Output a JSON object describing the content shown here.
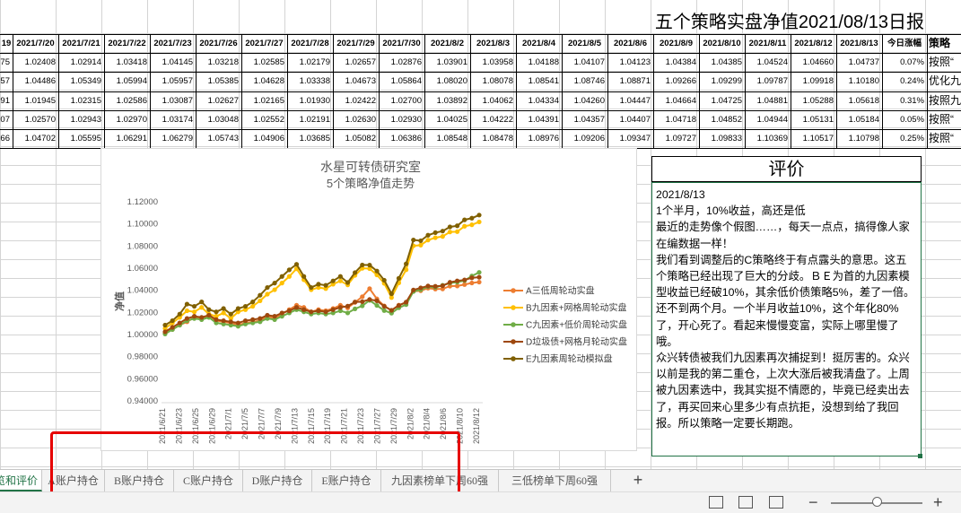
{
  "sheet_title": "五个策略实盘净值2021/08/13日报",
  "table": {
    "first_header": "19",
    "dates": [
      "2021/7/20",
      "2021/7/21",
      "2021/7/22",
      "2021/7/23",
      "2021/7/26",
      "2021/7/27",
      "2021/7/28",
      "2021/7/29",
      "2021/7/30",
      "2021/8/2",
      "2021/8/3",
      "2021/8/4",
      "2021/8/5",
      "2021/8/6",
      "2021/8/9",
      "2021/8/10",
      "2021/8/11",
      "2021/8/12",
      "2021/8/13"
    ],
    "change_header": "今日涨幅",
    "strategy_header": "策略",
    "rows": [
      {
        "first": "75",
        "values": [
          "1.02408",
          "1.02914",
          "1.03418",
          "1.04145",
          "1.03218",
          "1.02585",
          "1.02179",
          "1.02657",
          "1.02876",
          "1.03901",
          "1.03958",
          "1.04188",
          "1.04107",
          "1.04123",
          "1.04384",
          "1.04385",
          "1.04524",
          "1.04660",
          "1.04737"
        ],
        "change": "0.07%",
        "strategy": "按照“"
      },
      {
        "first": "57",
        "values": [
          "1.04486",
          "1.05349",
          "1.05994",
          "1.05957",
          "1.05385",
          "1.04628",
          "1.03338",
          "1.04673",
          "1.05864",
          "1.08020",
          "1.08078",
          "1.08541",
          "1.08746",
          "1.08871",
          "1.09266",
          "1.09299",
          "1.09787",
          "1.09918",
          "1.10180"
        ],
        "change": "0.24%",
        "strategy": "优化九"
      },
      {
        "first": "91",
        "values": [
          "1.01945",
          "1.02315",
          "1.02586",
          "1.03087",
          "1.02627",
          "1.02165",
          "1.01930",
          "1.02422",
          "1.02700",
          "1.03892",
          "1.04062",
          "1.04334",
          "1.04260",
          "1.04447",
          "1.04664",
          "1.04725",
          "1.04881",
          "1.05288",
          "1.05618"
        ],
        "change": "0.31%",
        "strategy": "按照九"
      },
      {
        "first": "07",
        "values": [
          "1.02570",
          "1.02943",
          "1.02970",
          "1.03174",
          "1.03048",
          "1.02552",
          "1.02191",
          "1.02630",
          "1.02930",
          "1.04025",
          "1.04222",
          "1.04391",
          "1.04357",
          "1.04407",
          "1.04718",
          "1.04852",
          "1.04944",
          "1.05131",
          "1.05184"
        ],
        "change": "0.05%",
        "strategy": "按照“"
      },
      {
        "first": "66",
        "values": [
          "1.04702",
          "1.05595",
          "1.06291",
          "1.06279",
          "1.05743",
          "1.04906",
          "1.03685",
          "1.05082",
          "1.06386",
          "1.08548",
          "1.08478",
          "1.08976",
          "1.09206",
          "1.09347",
          "1.09727",
          "1.09833",
          "1.10369",
          "1.10517",
          "1.10798"
        ],
        "change": "0.25%",
        "strategy": "按照“"
      }
    ]
  },
  "chart_data": {
    "type": "line",
    "title": "水星可转债研究室",
    "subtitle": "5个策略净值走势",
    "ylabel": "净值",
    "xlabel": "",
    "ylim": [
      0.94,
      1.12
    ],
    "yticks": [
      "0.94000",
      "0.96000",
      "0.98000",
      "1.00000",
      "1.02000",
      "1.04000",
      "1.06000",
      "1.08000",
      "1.10000",
      "1.12000"
    ],
    "x_labels": [
      "2021/6/21",
      "2021/6/23",
      "2021/6/25",
      "2021/6/29",
      "2021/7/1",
      "2021/7/5",
      "2021/7/7",
      "2021/7/9",
      "2021/7/13",
      "2021/7/15",
      "2021/7/19",
      "2021/7/21",
      "2021/7/23",
      "2021/7/27",
      "2021/7/29",
      "2021/8/2",
      "2021/8/4",
      "2021/8/6",
      "2021/8/10",
      "2021/8/12"
    ],
    "legend_position": "right",
    "series": [
      {
        "name": "A三低周轮动实盘",
        "color": "#ED7D31",
        "values": [
          1.0015,
          1.0045,
          1.0085,
          1.0115,
          1.0155,
          1.0145,
          1.0165,
          1.0125,
          1.0115,
          1.0105,
          1.0085,
          1.0105,
          1.0115,
          1.0125,
          1.0165,
          1.0145,
          1.0185,
          1.0225,
          1.0265,
          1.0245,
          1.0205,
          1.0225,
          1.0215,
          1.0235,
          1.0265,
          1.0241,
          1.0291,
          1.0342,
          1.0415,
          1.0322,
          1.0259,
          1.0218,
          1.0266,
          1.0288,
          1.039,
          1.0396,
          1.0419,
          1.0411,
          1.0412,
          1.0438,
          1.0439,
          1.0452,
          1.0466,
          1.0474
        ]
      },
      {
        "name": "B九因素+网格周轮动实盘",
        "color": "#FFC000",
        "values": [
          1.0055,
          1.0105,
          1.0155,
          1.0215,
          1.0205,
          1.0245,
          1.0185,
          1.0165,
          1.0195,
          1.0145,
          1.0205,
          1.0225,
          1.0255,
          1.0305,
          1.0365,
          1.0405,
          1.0465,
          1.0525,
          1.0595,
          1.0495,
          1.0405,
          1.0425,
          1.0415,
          1.0455,
          1.0485,
          1.0449,
          1.0535,
          1.0599,
          1.0596,
          1.0539,
          1.0463,
          1.0334,
          1.0467,
          1.0586,
          1.0802,
          1.0808,
          1.0854,
          1.0875,
          1.0887,
          1.0927,
          1.093,
          1.0979,
          1.0992,
          1.1018
        ]
      },
      {
        "name": "C九因素+低价周轮动实盘",
        "color": "#70AD47",
        "values": [
          1.0005,
          1.0045,
          1.0085,
          1.0125,
          1.0145,
          1.0135,
          1.0155,
          1.0105,
          1.0095,
          1.0085,
          1.0075,
          1.0095,
          1.0105,
          1.0115,
          1.0145,
          1.0135,
          1.0165,
          1.0195,
          1.0225,
          1.0205,
          1.0185,
          1.0195,
          1.0185,
          1.0195,
          1.0215,
          1.0195,
          1.0232,
          1.0259,
          1.0309,
          1.0263,
          1.0217,
          1.0193,
          1.0242,
          1.027,
          1.0389,
          1.0406,
          1.0433,
          1.0426,
          1.0445,
          1.0466,
          1.0473,
          1.0488,
          1.0529,
          1.0562
        ]
      },
      {
        "name": "D垃圾债+网格月轮动实盘",
        "color": "#9E480E",
        "values": [
          1.0025,
          1.0065,
          1.0105,
          1.0145,
          1.0165,
          1.0155,
          1.0175,
          1.0135,
          1.0125,
          1.0115,
          1.0105,
          1.0125,
          1.0135,
          1.0145,
          1.0175,
          1.0165,
          1.0195,
          1.0215,
          1.0245,
          1.0225,
          1.0205,
          1.0215,
          1.0205,
          1.0225,
          1.0245,
          1.0257,
          1.0294,
          1.0297,
          1.0317,
          1.0305,
          1.0255,
          1.0219,
          1.0263,
          1.0293,
          1.0403,
          1.0422,
          1.0439,
          1.0436,
          1.0441,
          1.0472,
          1.0485,
          1.0494,
          1.0513,
          1.0518
        ]
      },
      {
        "name": "E九因素周轮动模拟盘",
        "color": "#806000",
        "values": [
          1.0085,
          1.0125,
          1.0185,
          1.0275,
          1.0255,
          1.0295,
          1.0225,
          1.0205,
          1.0235,
          1.0185,
          1.0235,
          1.0255,
          1.0295,
          1.0355,
          1.0425,
          1.0465,
          1.0525,
          1.0585,
          1.0635,
          1.0525,
          1.0425,
          1.0455,
          1.0445,
          1.0485,
          1.0525,
          1.047,
          1.056,
          1.0629,
          1.0628,
          1.0574,
          1.0491,
          1.0369,
          1.0508,
          1.0639,
          1.0855,
          1.0848,
          1.0898,
          1.0921,
          1.0935,
          1.0973,
          1.0983,
          1.1037,
          1.1052,
          1.108
        ]
      }
    ]
  },
  "evaluation": {
    "title": "评价",
    "paragraphs": [
      "2021/8/13",
      "1个半月，10%收益，高还是低",
      "最近的走势像个假图……，每天一点点，搞得像人家在编数据一样！",
      "我们看到调整后的C策略终于有点露头的意思。这五个策略已经出现了巨大的分歧。ＢＥ为首的九因素模型收益已经破10%，其余低价债策略5%，差了一倍。还不到两个月。一个半月收益10%，这个年化80%了，开心死了。看起来慢慢变富，实际上哪里慢了哦。",
      "众兴转债被我们九因素再次捕捉到！挺厉害的。众兴以前是我的第二重仓，上次大涨后被我清盘了。上周被九因素选中，我其实挺不情愿的，毕竟已经卖出去了，再买回来心里多少有点抗拒，没想到给了我回报。所以策略一定要长期跑。"
    ]
  },
  "tabs": {
    "items": [
      {
        "label": "览和评价",
        "active": true
      },
      {
        "label": "A账户持仓",
        "active": false
      },
      {
        "label": "B账户持仓",
        "active": false
      },
      {
        "label": "C账户持仓",
        "active": false
      },
      {
        "label": "D账户持仓",
        "active": false
      },
      {
        "label": "E账户持仓",
        "active": false
      },
      {
        "label": "九因素榜单下周60强",
        "active": false
      },
      {
        "label": "三低榜单下周60强",
        "active": false
      }
    ],
    "add_label": "+"
  },
  "status": {
    "zoom_minus": "−",
    "zoom_plus": "+",
    "accent": "#217346"
  }
}
